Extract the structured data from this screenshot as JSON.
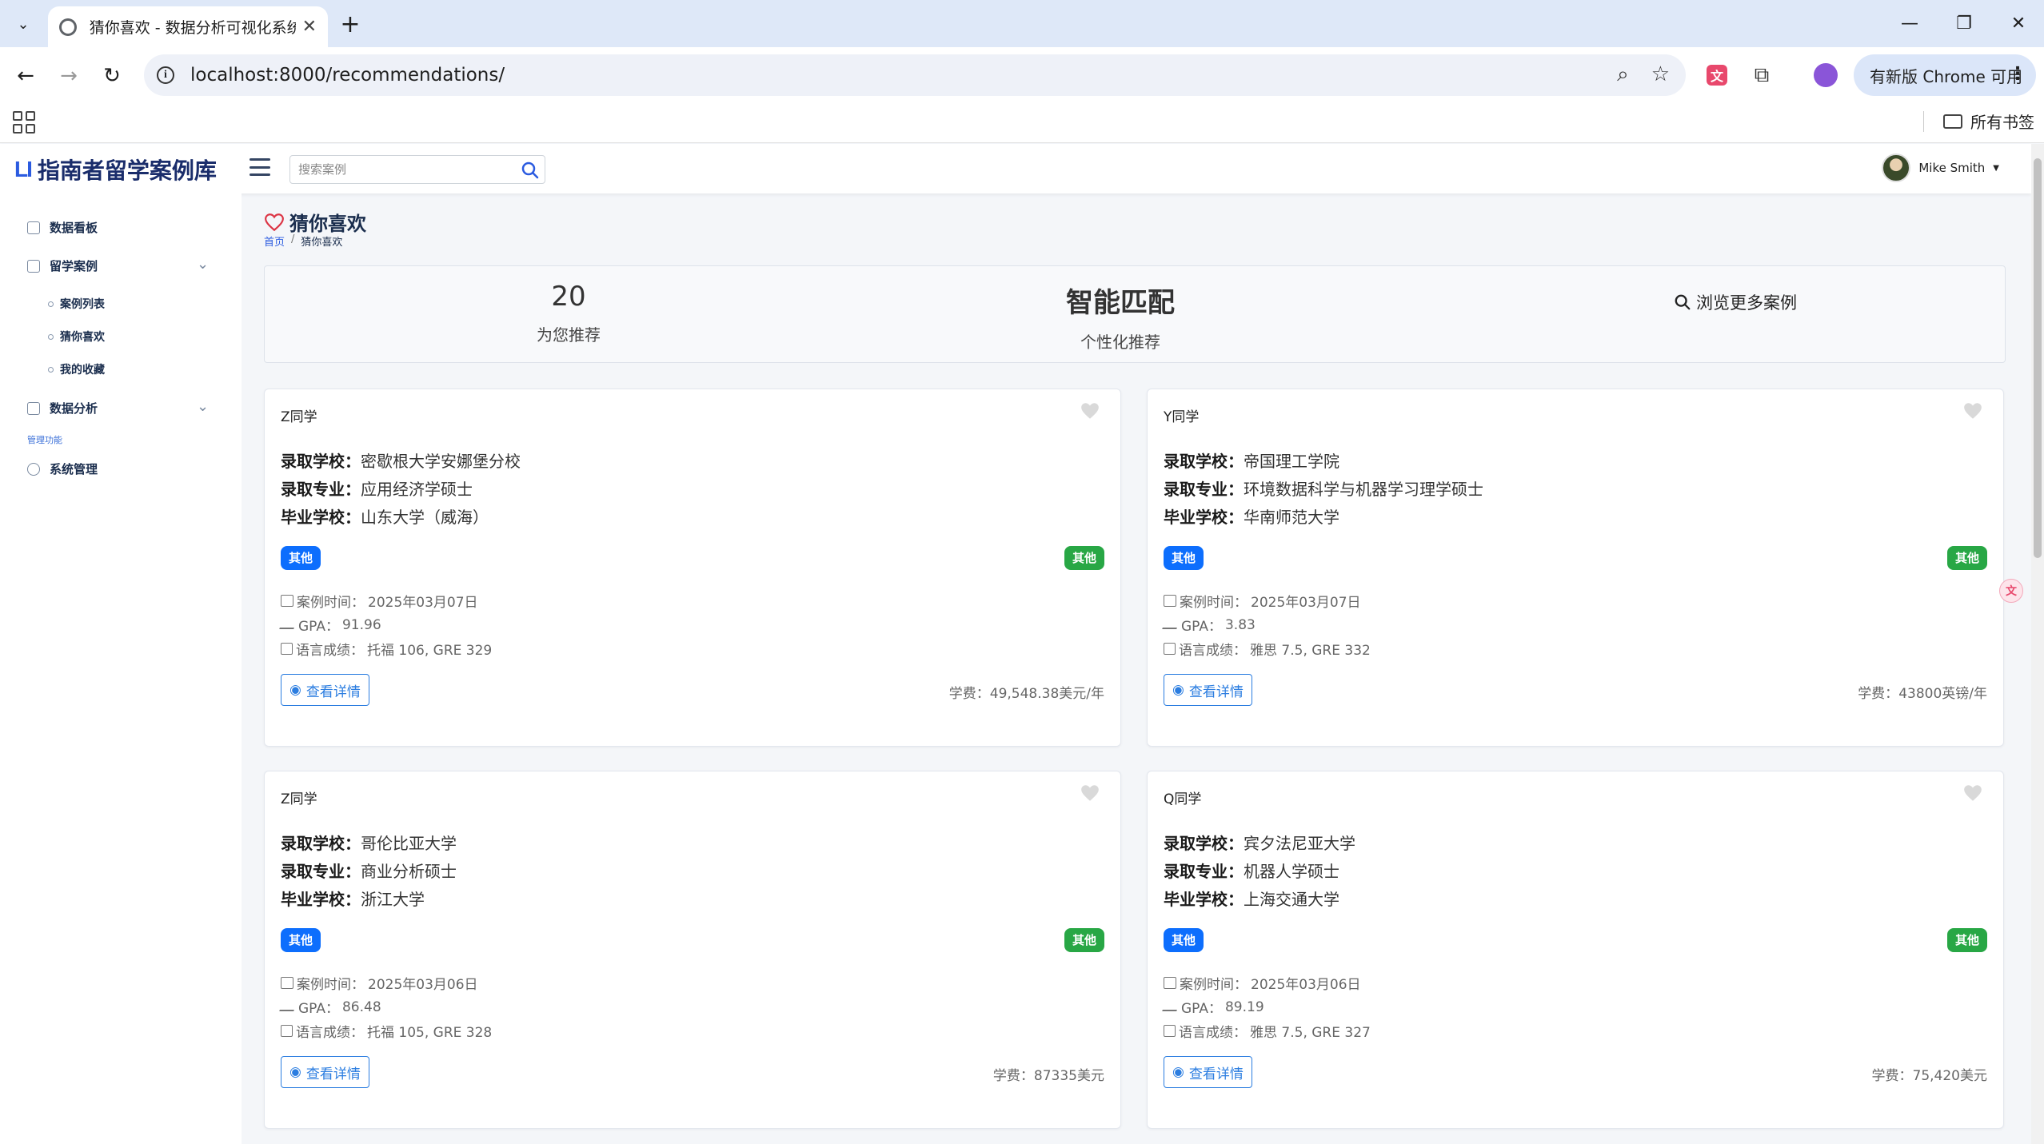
{
  "browser": {
    "tab_title": "猜你喜欢 - 数据分析可视化系统",
    "url": "localhost:8000/recommendations/",
    "update_button": "有新版 Chrome 可用",
    "all_bookmarks": "所有书签"
  },
  "header": {
    "brand_logo": "LI",
    "brand_name": "指南者留学案例库",
    "search_placeholder": "搜索案例",
    "user_name": "Mike Smith"
  },
  "sidebar": {
    "dashboard": "数据看板",
    "cases": "留学案例",
    "case_list": "案例列表",
    "guess_like": "猜你喜欢",
    "my_favorites": "我的收藏",
    "data_analysis": "数据分析",
    "admin_section": "管理功能",
    "system_admin": "系统管理"
  },
  "page": {
    "title": "猜你喜欢",
    "breadcrumb_home": "首页",
    "breadcrumb_sep": "/",
    "breadcrumb_current": "猜你喜欢"
  },
  "stats": {
    "count_value": "20",
    "count_label": "为您推荐",
    "match_value": "智能匹配",
    "match_label": "个性化推荐",
    "browse_more": "浏览更多案例"
  },
  "labels": {
    "school": "录取学校：",
    "major": "录取专业：",
    "grad": "毕业学校：",
    "case_time": "案例时间：",
    "gpa": "GPA：",
    "language": "语言成绩：",
    "detail": "查看详情",
    "tuition": "学费："
  },
  "cards": [
    {
      "name": "Z同学",
      "school": "密歇根大学安娜堡分校",
      "major": "应用经济学硕士",
      "grad": "山东大学（威海）",
      "tag1": "其他",
      "tag2": "其他",
      "date": "2025年03月07日",
      "gpa": "91.96",
      "language": "托福 106, GRE 329",
      "tuition": "49,548.38美元/年"
    },
    {
      "name": "Y同学",
      "school": "帝国理工学院",
      "major": "环境数据科学与机器学习理学硕士",
      "grad": "华南师范大学",
      "tag1": "其他",
      "tag2": "其他",
      "date": "2025年03月07日",
      "gpa": "3.83",
      "language": "雅思 7.5, GRE 332",
      "tuition": "43800英镑/年"
    },
    {
      "name": "Z同学",
      "school": "哥伦比亚大学",
      "major": "商业分析硕士",
      "grad": "浙江大学",
      "tag1": "其他",
      "tag2": "其他",
      "date": "2025年03月06日",
      "gpa": "86.48",
      "language": "托福 105, GRE 328",
      "tuition": "87335美元"
    },
    {
      "name": "Q同学",
      "school": "宾夕法尼亚大学",
      "major": "机器人学硕士",
      "grad": "上海交通大学",
      "tag1": "其他",
      "tag2": "其他",
      "date": "2025年03月06日",
      "gpa": "89.19",
      "language": "雅思 7.5, GRE 327",
      "tuition": "75,420美元"
    }
  ],
  "colors": {
    "primary": "#0d6efd",
    "success": "#28a745",
    "heart_red": "#dc3545",
    "brand": "#2b5be0"
  }
}
